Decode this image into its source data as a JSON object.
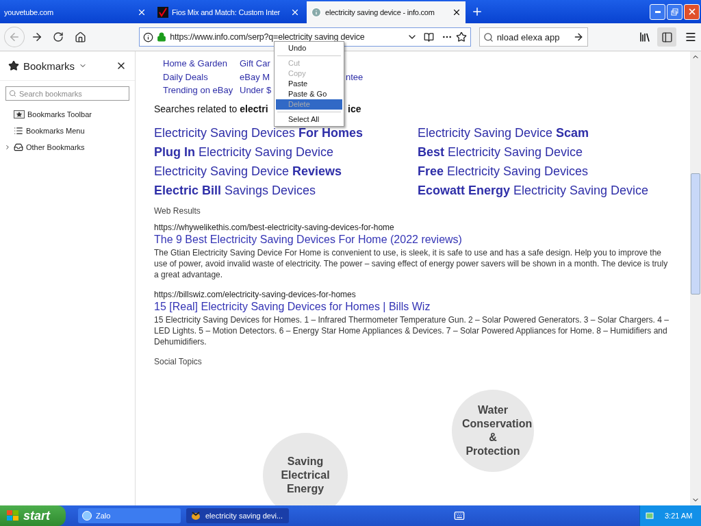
{
  "tabs": [
    {
      "title": "youvetube.com",
      "selected": false
    },
    {
      "title": "Fios Mix and Match: Custom Inter",
      "selected": false
    },
    {
      "title": "electricity saving device - info.com",
      "selected": true
    }
  ],
  "toolbar": {
    "url": "https://www.info.com/serp?q=electricity saving device",
    "search": "nload elexa app"
  },
  "sidebar": {
    "title": "Bookmarks",
    "search_placeholder": "Search bookmarks",
    "items": [
      {
        "label": "Bookmarks Toolbar",
        "kind": "toolbar"
      },
      {
        "label": "Bookmarks Menu",
        "kind": "menu"
      },
      {
        "label": "Other Bookmarks",
        "kind": "folder",
        "expanded": false
      }
    ]
  },
  "context_menu": [
    {
      "kind": "item",
      "label": "Undo",
      "disabled": false,
      "selected": false
    },
    {
      "kind": "separator"
    },
    {
      "kind": "item",
      "label": "Cut",
      "disabled": true,
      "selected": false
    },
    {
      "kind": "item",
      "label": "Copy",
      "disabled": true,
      "selected": false
    },
    {
      "kind": "item",
      "label": "Paste",
      "disabled": false,
      "selected": false
    },
    {
      "kind": "item",
      "label": "Paste & Go",
      "disabled": false,
      "selected": false
    },
    {
      "kind": "item",
      "label": "Delete",
      "disabled": true,
      "selected": true
    },
    {
      "kind": "separator"
    },
    {
      "kind": "item",
      "label": "Select All",
      "disabled": false,
      "selected": false
    }
  ],
  "page": {
    "nav_links": [
      [
        "Home & Garden",
        "Gift Car"
      ],
      [
        "Daily Deals",
        "eBay M",
        "ntee"
      ],
      [
        "Trending on eBay",
        "Under $"
      ]
    ],
    "related_heading": "Searches related to **electri**",
    "related_heading_tail": "**ice**",
    "related": [
      "Electricity Saving Devices **For Homes**",
      "**Plug In** Electricity Saving Device",
      "Electricity Saving Device **Reviews**",
      "**Electric Bill** Savings Devices",
      "Electricity Saving Device **Scam**",
      "**Best** Electricity Saving Device",
      "**Free** Electricity Saving Devices",
      "**Ecowatt Energy** Electricity Saving Device"
    ],
    "web_results_label": "Web Results",
    "results": [
      {
        "url": "https://whywelikethis.com/best-electricity-saving-devices-for-home",
        "title": "The 9 Best Electricity Saving Devices For Home (2022 reviews)",
        "snippet": "The Gtian Electricity Saving Device For Home is convenient to use, is sleek, it is safe to use and has a safe design. Help you to improve the use of power, avoid invalid waste of electricity. The power – saving effect of energy power savers will be shown in a month. The device is truly a great advantage."
      },
      {
        "url": "https://billswiz.com/electricity-saving-devices-for-homes",
        "title": "15 [Real] Electricity Saving Devices for Homes | Bills Wiz",
        "snippet": "15 Electricity Saving Devices for Homes. 1 – Infrared Thermometer Temperature Gun. 2 – Solar Powered Generators. 3 – Solar Chargers. 4 – LED Lights. 5 – Motion Detectors. 6 – Energy Star Home Appliances & Devices. 7 – Solar Powered Appliances for Home. 8 – Humidifiers and Dehumidifiers."
      }
    ],
    "social_label": "Social Topics",
    "topics": [
      "Water Conservation & Protection",
      "Saving Electrical Energy"
    ]
  },
  "taskbar": {
    "start": "start",
    "tasks": [
      {
        "label": "Zalo",
        "selected": false
      },
      {
        "label": "electricity saving devi...",
        "selected": true
      }
    ],
    "clock": "3:21 AM"
  }
}
